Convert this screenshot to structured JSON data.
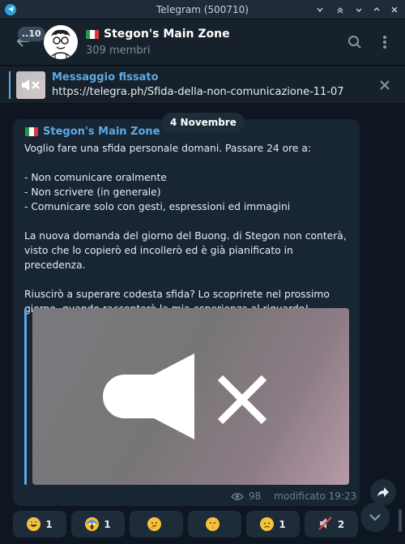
{
  "window": {
    "title": "Telegram (500710)"
  },
  "header": {
    "unread_count": "..10",
    "chat_name": "Stegon's Main Zone",
    "members": "309 membri"
  },
  "pinned": {
    "label": "Messaggio fissato",
    "link": "https://telegra.ph/Sfida-della-non-comunicazione-11-07"
  },
  "date_separator": "4 Novembre",
  "message": {
    "sender": "Stegon's Main Zone",
    "text": "Voglio fare una sfida personale domani. Passare 24 ore a:\n\n- Non comunicare oralmente\n- Non scrivere (in generale)\n- Comunicare solo con gesti, espressioni ed immagini\n\nLa nuova domanda del giorno del Buong. di Stegon non conterà, visto che lo copierò ed incollerò ed è già pianificato in precedenza.\n\nRiuscirò a superare codesta sfida? Lo scoprirete nel prossimo giorno, quando racconterò la mia esperienza al riguardo!",
    "views": "98",
    "edited": "modificato 19:23"
  },
  "reactions": [
    {
      "icon": "grinning-sweat-emoji",
      "count": "1"
    },
    {
      "icon": "screaming-emoji",
      "count": "1"
    },
    {
      "icon": "thinking-emoji",
      "count": ""
    },
    {
      "icon": "shushing-emoji",
      "count": ""
    },
    {
      "icon": "worried-emoji",
      "count": "1"
    },
    {
      "icon": "muted-speaker-emoji",
      "count": "2"
    }
  ],
  "colors": {
    "accent": "#5eaae4",
    "background": "#0e1621",
    "bubble": "#182533",
    "header": "#17212b"
  }
}
